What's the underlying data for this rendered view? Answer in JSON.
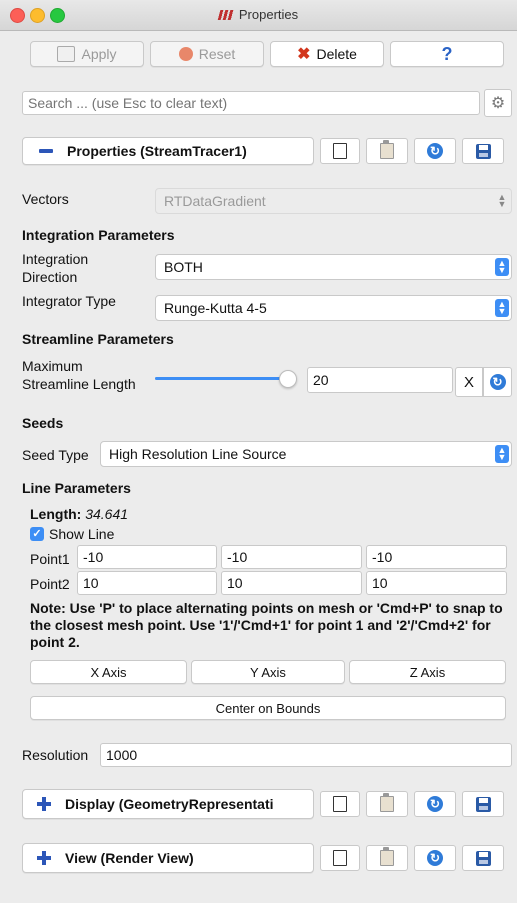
{
  "window": {
    "title": "Properties"
  },
  "toolbar": {
    "apply_label": "Apply",
    "reset_label": "Reset",
    "delete_label": "Delete",
    "help_label": "?"
  },
  "search": {
    "placeholder": "Search ... (use Esc to clear text)"
  },
  "properties_panel": {
    "header": "Properties (StreamTracer1)"
  },
  "vectors": {
    "label": "Vectors",
    "value": "RTDataGradient"
  },
  "integration": {
    "section": "Integration Parameters",
    "direction_label": "Integration Direction",
    "direction_value": "BOTH",
    "integrator_label": "Integrator Type",
    "integrator_value": "Runge-Kutta 4-5"
  },
  "streamline": {
    "section": "Streamline Parameters",
    "max_length_label": "Maximum Streamline Length",
    "max_length_value": "20",
    "max_length_slider_fraction": 1.0,
    "reset_x": "X"
  },
  "seeds": {
    "section": "Seeds",
    "seed_type_label": "Seed Type",
    "seed_type_value": "High Resolution Line Source"
  },
  "line": {
    "section": "Line Parameters",
    "length_label": "Length:",
    "length_value": "34.641",
    "show_line_label": "Show Line",
    "show_line_checked": true,
    "point1_label": "Point1",
    "point1": [
      "-10",
      "-10",
      "-10"
    ],
    "point2_label": "Point2",
    "point2": [
      "10",
      "10",
      "10"
    ],
    "note": "Note: Use 'P' to place alternating points on mesh or 'Cmd+P' to snap to the closest mesh point. Use '1'/'Cmd+1' for point 1 and '2'/'Cmd+2' for point 2.",
    "x_axis": "X Axis",
    "y_axis": "Y Axis",
    "z_axis": "Z Axis",
    "center_bounds": "Center on Bounds"
  },
  "resolution": {
    "label": "Resolution",
    "value": "1000"
  },
  "display_panel": {
    "header": "Display (GeometryRepresentati"
  },
  "view_panel": {
    "header": "View (Render View)"
  },
  "colors": {
    "accent": "#3d8ef5",
    "panel_icon": "#2c56b8",
    "delete": "#d2361d"
  }
}
